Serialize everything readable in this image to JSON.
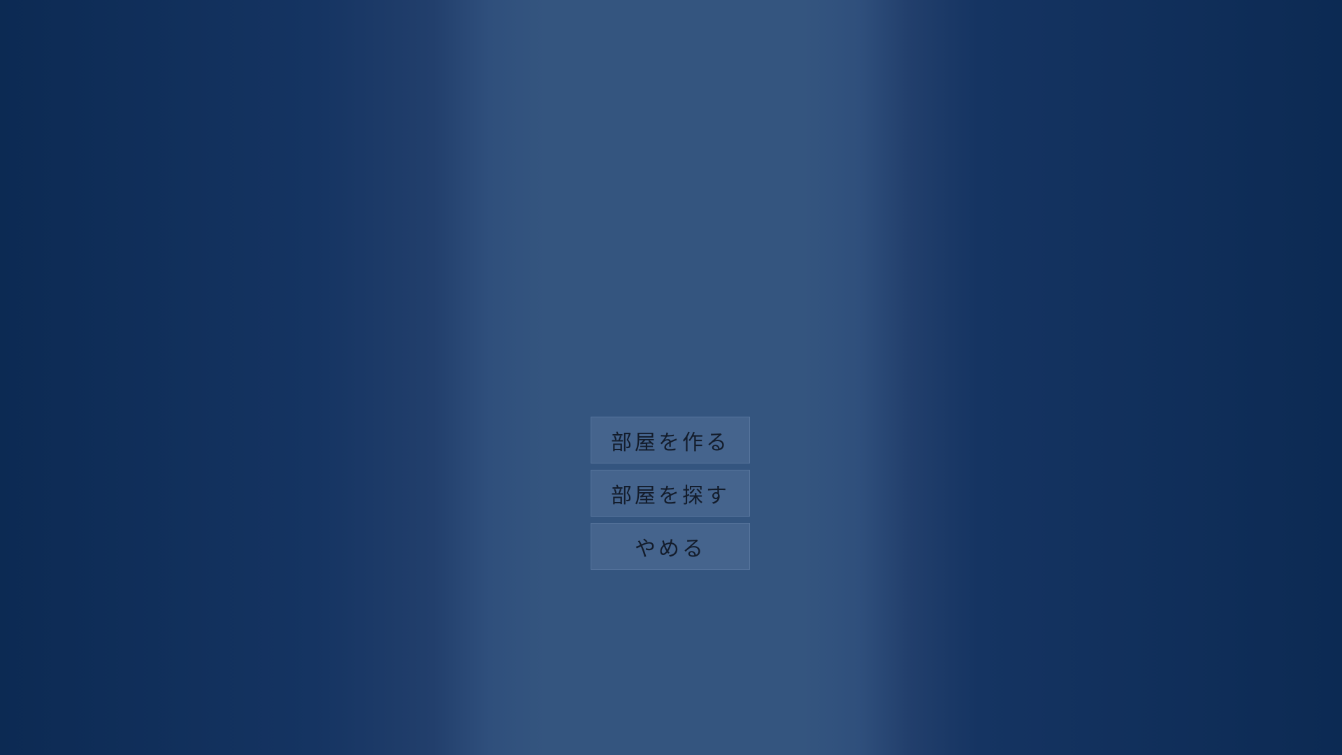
{
  "menu": {
    "items": [
      {
        "label": "部屋を作る"
      },
      {
        "label": "部屋を探す"
      },
      {
        "label": "やめる"
      }
    ]
  },
  "colors": {
    "background_edge": "#0c2a53",
    "background_center": "#34557f",
    "button_text": "#131c2b"
  }
}
